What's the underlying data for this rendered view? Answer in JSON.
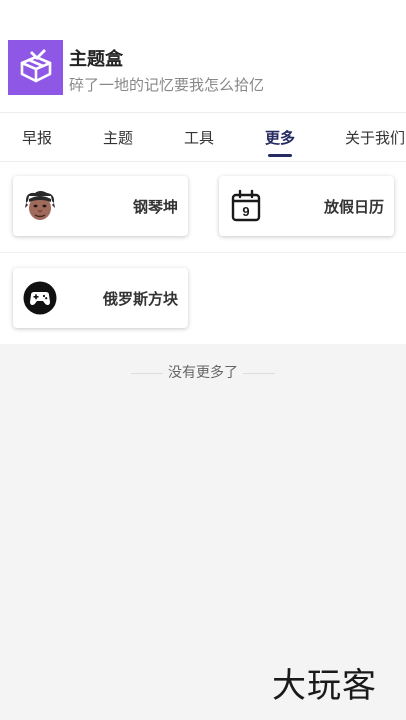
{
  "app": {
    "title": "主题盒",
    "subtitle": "碎了一地的记忆要我怎么拾亿",
    "logo_icon": "gift-box-icon",
    "brand_color": "#8f57e5"
  },
  "tabs": {
    "items": [
      {
        "label": "早报",
        "active": false
      },
      {
        "label": "主题",
        "active": false
      },
      {
        "label": "工具",
        "active": false
      },
      {
        "label": "更多",
        "active": true
      },
      {
        "label": "关于我们",
        "active": false
      }
    ],
    "active_color": "#252a61"
  },
  "cards": [
    {
      "label": "钢琴坤",
      "icon": "avatar-face-icon"
    },
    {
      "label": "放假日历",
      "icon": "calendar-icon",
      "icon_text": "9"
    },
    {
      "label": "俄罗斯方块",
      "icon": "gamepad-icon"
    }
  ],
  "footer": {
    "end_text": "没有更多了"
  },
  "watermark": {
    "text": "大玩客"
  }
}
